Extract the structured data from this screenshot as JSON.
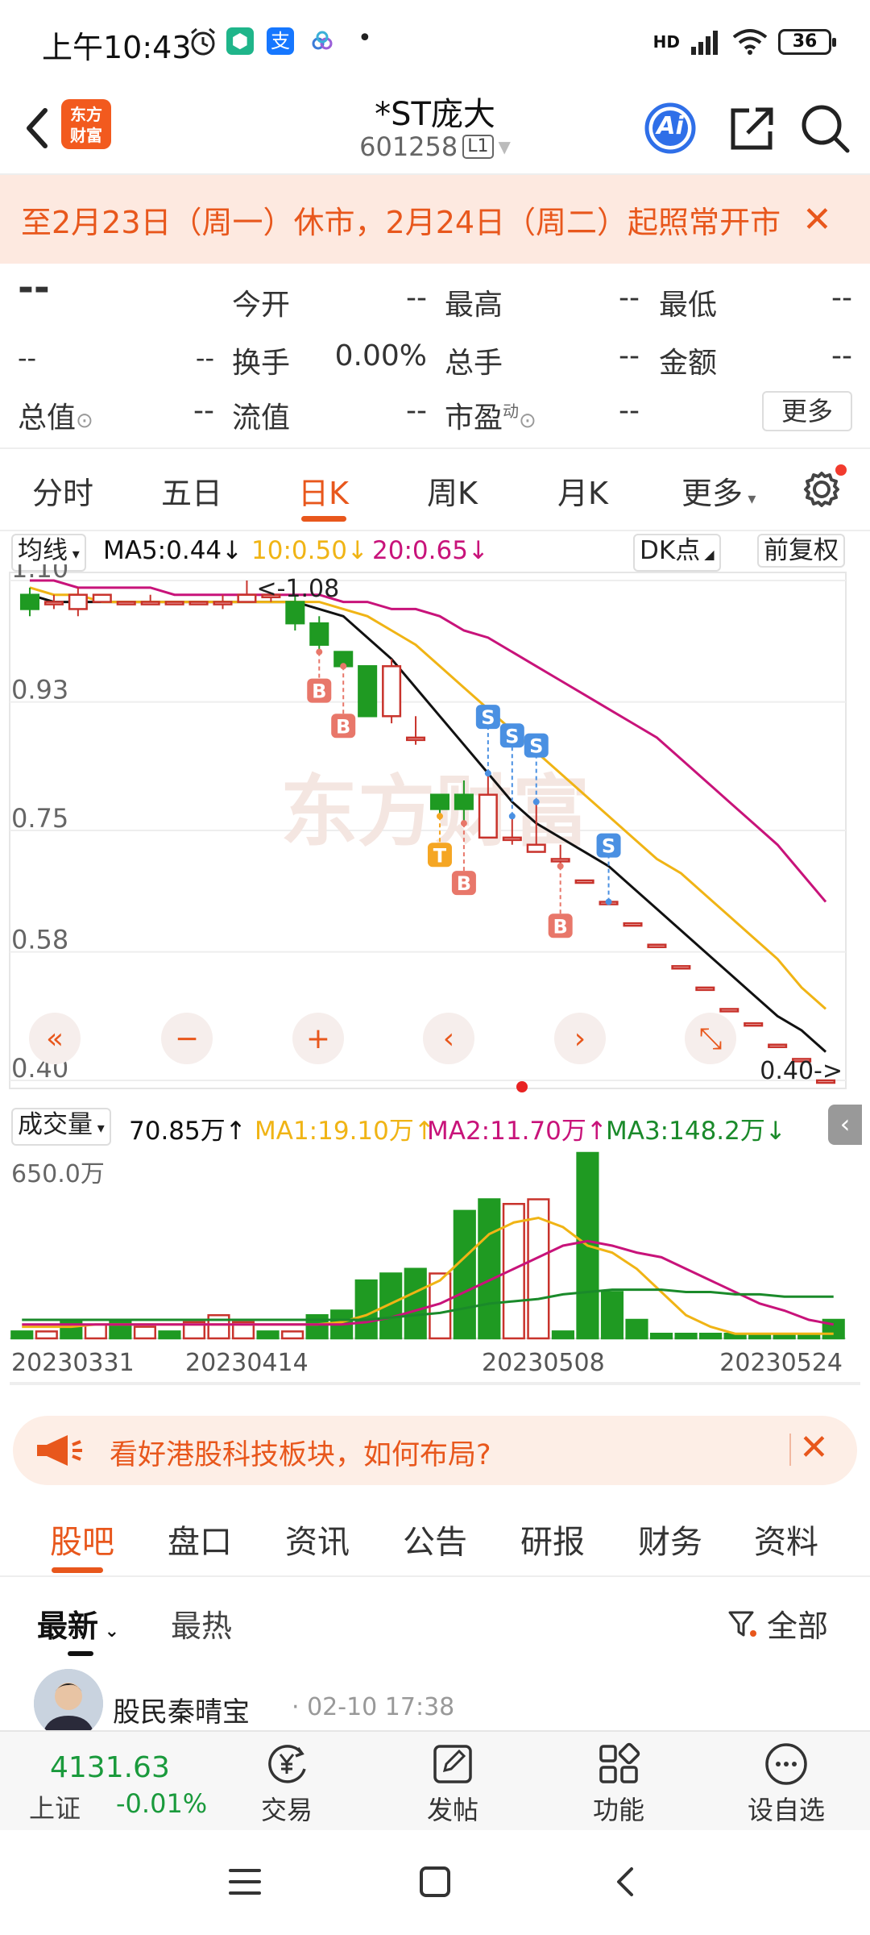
{
  "status": {
    "time": "上午10:43",
    "alipay_badge": "支",
    "dot": "•",
    "network": "HD",
    "battery": "36"
  },
  "header": {
    "logo_line1": "东方",
    "logo_line2": "财富",
    "stock_name": "*ST庞大",
    "stock_code": "601258",
    "level_badge": "L1",
    "ai_label": "Ai"
  },
  "notice": {
    "text": "至2月23日（周一）休市，2月24日（周二）起照常开市",
    "close": "✕"
  },
  "quote": {
    "price": "--",
    "change": "--",
    "change_pct": "--",
    "labels": {
      "open": "今开",
      "high": "最高",
      "low": "最低",
      "turnover": "换手",
      "volume": "总手",
      "amount": "金额",
      "mktcap": "总值",
      "float_cap": "流值",
      "pe": "市盈",
      "pe_sup": "动"
    },
    "values": {
      "open": "--",
      "high": "--",
      "low": "--",
      "turnover": "0.00%",
      "volume": "--",
      "amount": "--",
      "mktcap": "--",
      "float_cap": "--",
      "pe": "--"
    },
    "more": "更多"
  },
  "period_tabs": [
    "分时",
    "五日",
    "日K",
    "周K",
    "月K",
    "更多"
  ],
  "ma_row": {
    "selector": "均线",
    "ma5": "MA5:0.44",
    "ma10": "10:0.50",
    "ma20": "20:0.65",
    "dk_label": "DK点",
    "adjust_label": "前复权",
    "colors": {
      "ma5": "#111111",
      "ma10": "#f0b415",
      "ma20": "#c8137a"
    }
  },
  "chart_data": [
    {
      "type": "candlestick",
      "title": "",
      "y_ticks": [
        "1.10",
        "0.93",
        "0.75",
        "0.58",
        "0.40"
      ],
      "ylim": [
        0.4,
        1.1
      ],
      "annotations": {
        "max_label": "<-1.08",
        "last_label": "0.40->"
      },
      "watermark": "东方财富",
      "candles": [
        {
          "o": 1.08,
          "c": 1.06,
          "h": 1.09,
          "l": 1.05
        },
        {
          "o": 1.07,
          "c": 1.07,
          "h": 1.08,
          "l": 1.06
        },
        {
          "o": 1.06,
          "c": 1.08,
          "h": 1.09,
          "l": 1.05
        },
        {
          "o": 1.07,
          "c": 1.08,
          "h": 1.08,
          "l": 1.07
        },
        {
          "o": 1.07,
          "c": 1.07,
          "h": 1.07,
          "l": 1.07
        },
        {
          "o": 1.07,
          "c": 1.07,
          "h": 1.08,
          "l": 1.07
        },
        {
          "o": 1.07,
          "c": 1.07,
          "h": 1.07,
          "l": 1.07
        },
        {
          "o": 1.07,
          "c": 1.07,
          "h": 1.07,
          "l": 1.07
        },
        {
          "o": 1.07,
          "c": 1.07,
          "h": 1.08,
          "l": 1.06
        },
        {
          "o": 1.07,
          "c": 1.08,
          "h": 1.1,
          "l": 1.07
        },
        {
          "o": 1.08,
          "c": 1.08,
          "h": 1.08,
          "l": 1.07
        },
        {
          "o": 1.07,
          "c": 1.04,
          "h": 1.08,
          "l": 1.03
        },
        {
          "o": 1.04,
          "c": 1.01,
          "h": 1.05,
          "l": 1.0
        },
        {
          "o": 1.0,
          "c": 0.98,
          "h": 1.0,
          "l": 0.98
        },
        {
          "o": 0.98,
          "c": 0.91,
          "h": 0.98,
          "l": 0.91
        },
        {
          "o": 0.91,
          "c": 0.98,
          "h": 0.99,
          "l": 0.9
        },
        {
          "o": 0.88,
          "c": 0.88,
          "h": 0.91,
          "l": 0.87
        },
        {
          "o": 0.8,
          "c": 0.78,
          "h": 0.8,
          "l": 0.77
        },
        {
          "o": 0.8,
          "c": 0.78,
          "h": 0.82,
          "l": 0.76
        },
        {
          "o": 0.74,
          "c": 0.8,
          "h": 0.83,
          "l": 0.74
        },
        {
          "o": 0.74,
          "c": 0.74,
          "h": 0.77,
          "l": 0.73
        },
        {
          "o": 0.72,
          "c": 0.73,
          "h": 0.79,
          "l": 0.72
        },
        {
          "o": 0.71,
          "c": 0.71,
          "h": 0.73,
          "l": 0.7
        },
        {
          "o": 0.68,
          "c": 0.68,
          "h": 0.68,
          "l": 0.68
        },
        {
          "o": 0.65,
          "c": 0.65,
          "h": 0.65,
          "l": 0.65
        },
        {
          "o": 0.62,
          "c": 0.62,
          "h": 0.62,
          "l": 0.62
        },
        {
          "o": 0.59,
          "c": 0.59,
          "h": 0.59,
          "l": 0.59
        },
        {
          "o": 0.56,
          "c": 0.56,
          "h": 0.56,
          "l": 0.56
        },
        {
          "o": 0.53,
          "c": 0.53,
          "h": 0.53,
          "l": 0.53
        },
        {
          "o": 0.5,
          "c": 0.5,
          "h": 0.5,
          "l": 0.5
        },
        {
          "o": 0.48,
          "c": 0.48,
          "h": 0.48,
          "l": 0.48
        },
        {
          "o": 0.45,
          "c": 0.45,
          "h": 0.45,
          "l": 0.45
        },
        {
          "o": 0.43,
          "c": 0.43,
          "h": 0.43,
          "l": 0.43
        },
        {
          "o": 0.4,
          "c": 0.4,
          "h": 0.4,
          "l": 0.4
        }
      ],
      "series": [
        {
          "name": "MA5",
          "color": "#111111",
          "values": [
            1.08,
            1.07,
            1.07,
            1.07,
            1.07,
            1.07,
            1.07,
            1.07,
            1.07,
            1.07,
            1.07,
            1.07,
            1.06,
            1.05,
            1.02,
            0.99,
            0.95,
            0.91,
            0.87,
            0.83,
            0.79,
            0.76,
            0.74,
            0.72,
            0.7,
            0.67,
            0.64,
            0.61,
            0.58,
            0.55,
            0.52,
            0.49,
            0.47,
            0.44
          ]
        },
        {
          "name": "MA10",
          "color": "#f0b415",
          "values": [
            1.09,
            1.08,
            1.08,
            1.07,
            1.07,
            1.07,
            1.07,
            1.07,
            1.07,
            1.07,
            1.07,
            1.07,
            1.07,
            1.06,
            1.05,
            1.03,
            1.01,
            0.98,
            0.95,
            0.92,
            0.89,
            0.86,
            0.83,
            0.8,
            0.77,
            0.74,
            0.71,
            0.69,
            0.66,
            0.63,
            0.6,
            0.57,
            0.53,
            0.5
          ]
        },
        {
          "name": "MA20",
          "color": "#c8137a",
          "values": [
            1.1,
            1.1,
            1.09,
            1.09,
            1.09,
            1.09,
            1.08,
            1.08,
            1.08,
            1.08,
            1.08,
            1.08,
            1.08,
            1.07,
            1.07,
            1.06,
            1.06,
            1.05,
            1.03,
            1.02,
            1.0,
            0.98,
            0.96,
            0.94,
            0.92,
            0.9,
            0.88,
            0.85,
            0.82,
            0.79,
            0.76,
            0.73,
            0.69,
            0.65
          ]
        }
      ],
      "signals": [
        {
          "i": 12,
          "label": "B"
        },
        {
          "i": 13,
          "label": "B"
        },
        {
          "i": 17,
          "label": "T"
        },
        {
          "i": 18,
          "label": "B"
        },
        {
          "i": 19,
          "label": "S"
        },
        {
          "i": 20,
          "label": "S"
        },
        {
          "i": 21,
          "label": "S"
        },
        {
          "i": 22,
          "label": "B"
        },
        {
          "i": 24,
          "label": "S"
        }
      ],
      "controls": [
        "«",
        "−",
        "+",
        "‹",
        "›",
        "⤡"
      ]
    },
    {
      "type": "bar",
      "title": "",
      "label": "成交量",
      "current": "70.85万",
      "ma1": "MA1:19.10万",
      "ma2": "MA2:11.70万",
      "ma3": "MA3:148.2万",
      "y_max_label": "650.0万",
      "x_ticks": [
        "20230331",
        "20230414",
        "20230508",
        "20230524"
      ],
      "ylim": [
        0,
        650
      ],
      "values": [
        3,
        3,
        8,
        6,
        8,
        5,
        3,
        7,
        10,
        7,
        3,
        3,
        10,
        12,
        25,
        28,
        30,
        28,
        55,
        60,
        58,
        60,
        3,
        80,
        20,
        8,
        2,
        2,
        2,
        2,
        2,
        2,
        2,
        8
      ],
      "up": [
        false,
        true,
        false,
        true,
        false,
        true,
        false,
        true,
        true,
        true,
        false,
        true,
        false,
        false,
        false,
        false,
        false,
        true,
        false,
        false,
        true,
        true,
        false,
        false,
        false,
        false,
        false,
        false,
        false,
        false,
        false,
        false,
        false,
        false
      ],
      "series": [
        {
          "name": "MA1",
          "color": "#f0b415",
          "values": [
            5,
            5,
            5,
            6,
            6,
            6,
            6,
            6,
            6,
            6,
            6,
            6,
            6,
            7,
            10,
            15,
            20,
            25,
            35,
            45,
            50,
            52,
            48,
            40,
            37,
            30,
            20,
            10,
            5,
            2,
            2,
            2,
            2,
            2
          ]
        },
        {
          "name": "MA2",
          "color": "#c8137a",
          "values": [
            6,
            6,
            6,
            6,
            6,
            6,
            6,
            6,
            6,
            6,
            6,
            6,
            6,
            6,
            7,
            9,
            12,
            15,
            20,
            25,
            30,
            35,
            40,
            42,
            40,
            37,
            35,
            30,
            25,
            20,
            15,
            12,
            8,
            6
          ]
        },
        {
          "name": "MA3",
          "color": "#1a8a2a",
          "values": [
            8,
            8,
            8,
            8,
            8,
            8,
            8,
            8,
            8,
            8,
            8,
            8,
            8,
            8,
            8,
            9,
            10,
            11,
            13,
            15,
            16,
            17,
            19,
            20,
            21,
            21,
            21,
            20,
            20,
            19,
            19,
            18,
            18,
            18
          ]
        }
      ]
    }
  ],
  "ad": {
    "text": "看好港股科技板块，如何布局?",
    "close": "✕"
  },
  "content_tabs": [
    "股吧",
    "盘口",
    "资讯",
    "公告",
    "研报",
    "财务",
    "资料"
  ],
  "sort": {
    "latest": "最新",
    "hot": "最热",
    "filter": "全部"
  },
  "post": {
    "author": "股民秦晴宝",
    "time": "· 02-10 17:38"
  },
  "bottom_nav": {
    "index_value": "4131.63",
    "index_name": "上证",
    "index_change": "-0.01%",
    "items": [
      "交易",
      "发帖",
      "功能",
      "设自选"
    ]
  }
}
